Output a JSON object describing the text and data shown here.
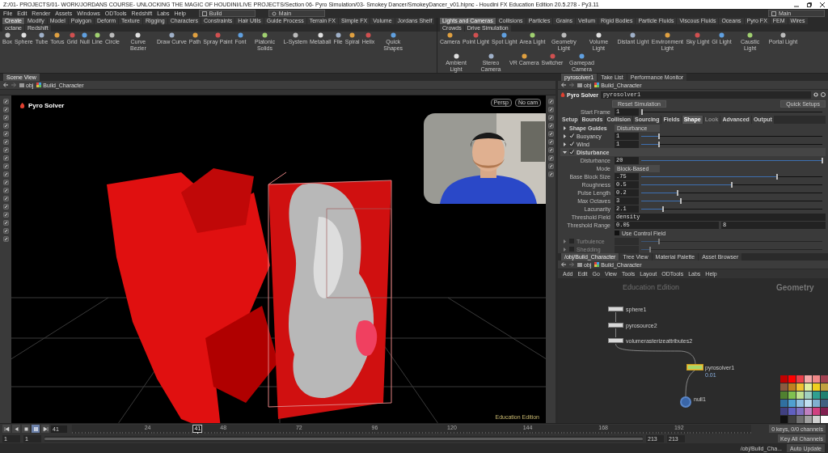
{
  "window": {
    "title": "Z:/01- PROJECTS/01- WORK/JORDANS COURSE- UNLOCKING THE MAGIC OF HOUDINI/LIVE PROJECTS/Section 06- Pyro Simulation/03- Smokey Dancer/SmokeyDancer_v01.hipnc - Houdini FX Education Edition 20.5.278 - Py3.11"
  },
  "menu_bar": {
    "items": [
      "File",
      "Edit",
      "Render",
      "Assets",
      "Windows",
      "ODTools",
      "Redshift",
      "Labs",
      "Help"
    ],
    "desktop": "Build",
    "context": "Main",
    "right_desktop": "Main"
  },
  "shelves": [
    {
      "tabs": [
        {
          "label": "Create",
          "selected": true
        },
        {
          "label": "Modify",
          "selected": false
        },
        {
          "label": "Model",
          "selected": false
        },
        {
          "label": "Polygon",
          "selected": false
        },
        {
          "label": "Deform",
          "selected": false
        },
        {
          "label": "Texture",
          "selected": false
        },
        {
          "label": "Rigging",
          "selected": false
        },
        {
          "label": "Characters",
          "selected": false
        },
        {
          "label": "Constraints",
          "selected": false
        },
        {
          "label": "Hair Utils",
          "selected": false
        },
        {
          "label": "Guide Process",
          "selected": false
        },
        {
          "label": "Terrain FX",
          "selected": false
        },
        {
          "label": "Simple FX",
          "selected": false
        },
        {
          "label": "Volume",
          "selected": false
        },
        {
          "label": "Jordans Shelf",
          "selected": false
        },
        {
          "label": "octane",
          "selected": false
        },
        {
          "label": "Redshift",
          "selected": false
        }
      ],
      "tools": [
        "Box",
        "Sphere",
        "Tube",
        "Torus",
        "Grid",
        "Null",
        "Line",
        "Circle",
        "Curve Bezier",
        "Draw Curve",
        "Path",
        "Spray Paint",
        "Font",
        "Platonic Solids",
        "L-System",
        "Metaball",
        "File",
        "Spiral",
        "Helix",
        "Quick Shapes"
      ]
    },
    {
      "tabs": [
        {
          "label": "Lights and Cameras",
          "selected": true
        },
        {
          "label": "Collisions",
          "selected": false
        },
        {
          "label": "Particles",
          "selected": false
        },
        {
          "label": "Grains",
          "selected": false
        },
        {
          "label": "Vellum",
          "selected": false
        },
        {
          "label": "Rigid Bodies",
          "selected": false
        },
        {
          "label": "Particle Fluids",
          "selected": false
        },
        {
          "label": "Viscous Fluids",
          "selected": false
        },
        {
          "label": "Oceans",
          "selected": false
        },
        {
          "label": "Pyro FX",
          "selected": false
        },
        {
          "label": "FEM",
          "selected": false
        },
        {
          "label": "Wires",
          "selected": false
        },
        {
          "label": "Crowds",
          "selected": false
        },
        {
          "label": "Drive Simulation",
          "selected": false
        }
      ],
      "tools": [
        "Camera",
        "Point Light",
        "Spot Light",
        "Area Light",
        "Geometry Light",
        "Volume Light",
        "Distant Light",
        "Environment Light",
        "Sky Light",
        "GI Light",
        "Caustic Light",
        "Portal Light",
        "Ambient Light",
        "Stereo Camera",
        "VR Camera",
        "Switcher",
        "Gamepad Camera"
      ]
    }
  ],
  "scene_view": {
    "tabs": [
      {
        "label": "Scene View",
        "selected": true
      }
    ],
    "path": [
      "obj",
      "Build_Character"
    ],
    "node_label": "Pyro Solver",
    "camera_buttons": [
      "Persp",
      "No cam"
    ],
    "edition_label": "Education Edition"
  },
  "parameters": {
    "tabs": [
      {
        "label": "pyrosolver1",
        "selected": true
      },
      {
        "label": "Take List",
        "selected": false
      },
      {
        "label": "Performance Monitor",
        "selected": false
      }
    ],
    "path": [
      "obj",
      "Build_Character"
    ],
    "node_type": "Pyro Solver",
    "node_name": "pyrosolver1",
    "reset_button": "Reset Simulation",
    "quick_setups": "Quick Setups",
    "start_frame": {
      "label": "Start Frame",
      "value": "1",
      "level": 0
    },
    "param_tabs": [
      {
        "label": "Setup",
        "selected": false,
        "disabled": false
      },
      {
        "label": "Bounds",
        "selected": false,
        "disabled": false
      },
      {
        "label": "Collision",
        "selected": false,
        "disabled": false
      },
      {
        "label": "Sourcing",
        "selected": false,
        "disabled": false
      },
      {
        "label": "Fields",
        "selected": false,
        "disabled": false
      },
      {
        "label": "Shape",
        "selected": true,
        "disabled": false
      },
      {
        "label": "Look",
        "selected": false,
        "disabled": true
      },
      {
        "label": "Advanced",
        "selected": false,
        "disabled": false
      },
      {
        "label": "Output",
        "selected": false,
        "disabled": false
      }
    ],
    "rows": [
      {
        "kind": "folder_menu",
        "label": "Shape Guides",
        "expanded": false,
        "value": "Disturbance"
      },
      {
        "kind": "toggle_slider",
        "label": "Buoyancy",
        "expanded": false,
        "checked": true,
        "value": "1",
        "level": 0.1
      },
      {
        "kind": "toggle_slider",
        "label": "Wind",
        "expanded": false,
        "checked": true,
        "value": "1",
        "level": 0.1
      },
      {
        "kind": "folder",
        "label": "Disturbance",
        "expanded": true,
        "checked": true
      },
      {
        "kind": "slider",
        "label": "Disturbance",
        "value": "20",
        "level": 1.0
      },
      {
        "kind": "menu",
        "label": "Mode",
        "value": "Block-Based"
      },
      {
        "kind": "slider",
        "label": "Base Block Size",
        "value": ".75",
        "level": 0.75
      },
      {
        "kind": "slider",
        "label": "Roughness",
        "value": "0.5",
        "level": 0.5
      },
      {
        "kind": "slider",
        "label": "Pulse Length",
        "value": "0.2",
        "level": 0.2
      },
      {
        "kind": "slider",
        "label": "Max Octaves",
        "value": "3",
        "level": 0.22
      },
      {
        "kind": "slider",
        "label": "Lacunarity",
        "value": "2.1",
        "level": 0.12
      },
      {
        "kind": "text",
        "label": "Threshold Field",
        "value": "density"
      },
      {
        "kind": "pair",
        "label": "Threshold Range",
        "value": "0.05",
        "value2": "8"
      },
      {
        "kind": "checkbox",
        "label": "Use Control Field",
        "checked": false
      },
      {
        "kind": "toggle_slider",
        "label": "Turbulence",
        "expanded": false,
        "checked": false,
        "level": 0.1
      },
      {
        "kind": "toggle_slider",
        "label": "Shedding",
        "expanded": false,
        "checked": false,
        "level": 0.05
      }
    ]
  },
  "network": {
    "tabs": [
      {
        "label": "/obj/Build_Character",
        "selected": true
      },
      {
        "label": "Tree View",
        "selected": false
      },
      {
        "label": "Material Palette",
        "selected": false
      },
      {
        "label": "Asset Browser",
        "selected": false
      }
    ],
    "path": [
      "obj",
      "Build_Character"
    ],
    "menu": [
      "Add",
      "Edit",
      "Go",
      "View",
      "Tools",
      "Layout",
      "ODTools",
      "Labs",
      "Help"
    ],
    "edition_label": "Education Edition",
    "context_label": "Geometry",
    "nodes": [
      {
        "name": "sphere1",
        "kind": "box",
        "selected": false
      },
      {
        "name": "pyrosource2",
        "kind": "box",
        "selected": false
      },
      {
        "name": "volumerasterizeattributes2",
        "kind": "box",
        "selected": false
      },
      {
        "name": "pyrosolver1",
        "kind": "box",
        "selected": true,
        "info": "0.01"
      },
      {
        "name": "null1",
        "kind": "circle",
        "selected": false
      }
    ],
    "palette": [
      {
        "color": "#c00000"
      },
      {
        "color": "#ff0000"
      },
      {
        "color": "#e8404a"
      },
      {
        "color": "#f4a8a8"
      },
      {
        "color": "#f08888"
      },
      {
        "color": "#a04050"
      },
      {
        "color": "#8a5a40"
      },
      {
        "color": "#c08020"
      },
      {
        "color": "#f0c030"
      },
      {
        "color": "#e0f0a0"
      },
      {
        "color": "#f0d020"
      },
      {
        "color": "#c0a040"
      },
      {
        "color": "#508030"
      },
      {
        "color": "#80c050"
      },
      {
        "color": "#c0e090"
      },
      {
        "color": "#a0d0c0"
      },
      {
        "color": "#30a090"
      },
      {
        "color": "#208070"
      },
      {
        "color": "#3070a0"
      },
      {
        "color": "#50a0d0"
      },
      {
        "color": "#90c0e0"
      },
      {
        "color": "#c0e0f0"
      },
      {
        "color": "#80b0d0"
      },
      {
        "color": "#406080"
      },
      {
        "color": "#404080"
      },
      {
        "color": "#6060c0"
      },
      {
        "color": "#8070c0"
      },
      {
        "color": "#c080c0"
      },
      {
        "color": "#d04080"
      },
      {
        "color": "#802050"
      },
      {
        "color": "#101010"
      },
      {
        "color": "#404040"
      },
      {
        "color": "#707070"
      },
      {
        "color": "#a0a0a0"
      },
      {
        "color": "#d0d0d0"
      },
      {
        "color": "#ffffff"
      }
    ]
  },
  "timeline": {
    "frame": "41",
    "tick_labels": [
      "24",
      "48",
      "72",
      "96",
      "120",
      "144",
      "168",
      "192"
    ],
    "marker": "41",
    "level": 0.185,
    "range": [
      "1",
      "1",
      "213",
      "213"
    ],
    "range_slider": {
      "level": 1
    },
    "keys_info": "0 keys, 0/0 channels",
    "key_all": "Key All Channels"
  },
  "status_bar": {
    "path": "/obj/Build_Cha...",
    "update_mode": "Auto Update"
  }
}
